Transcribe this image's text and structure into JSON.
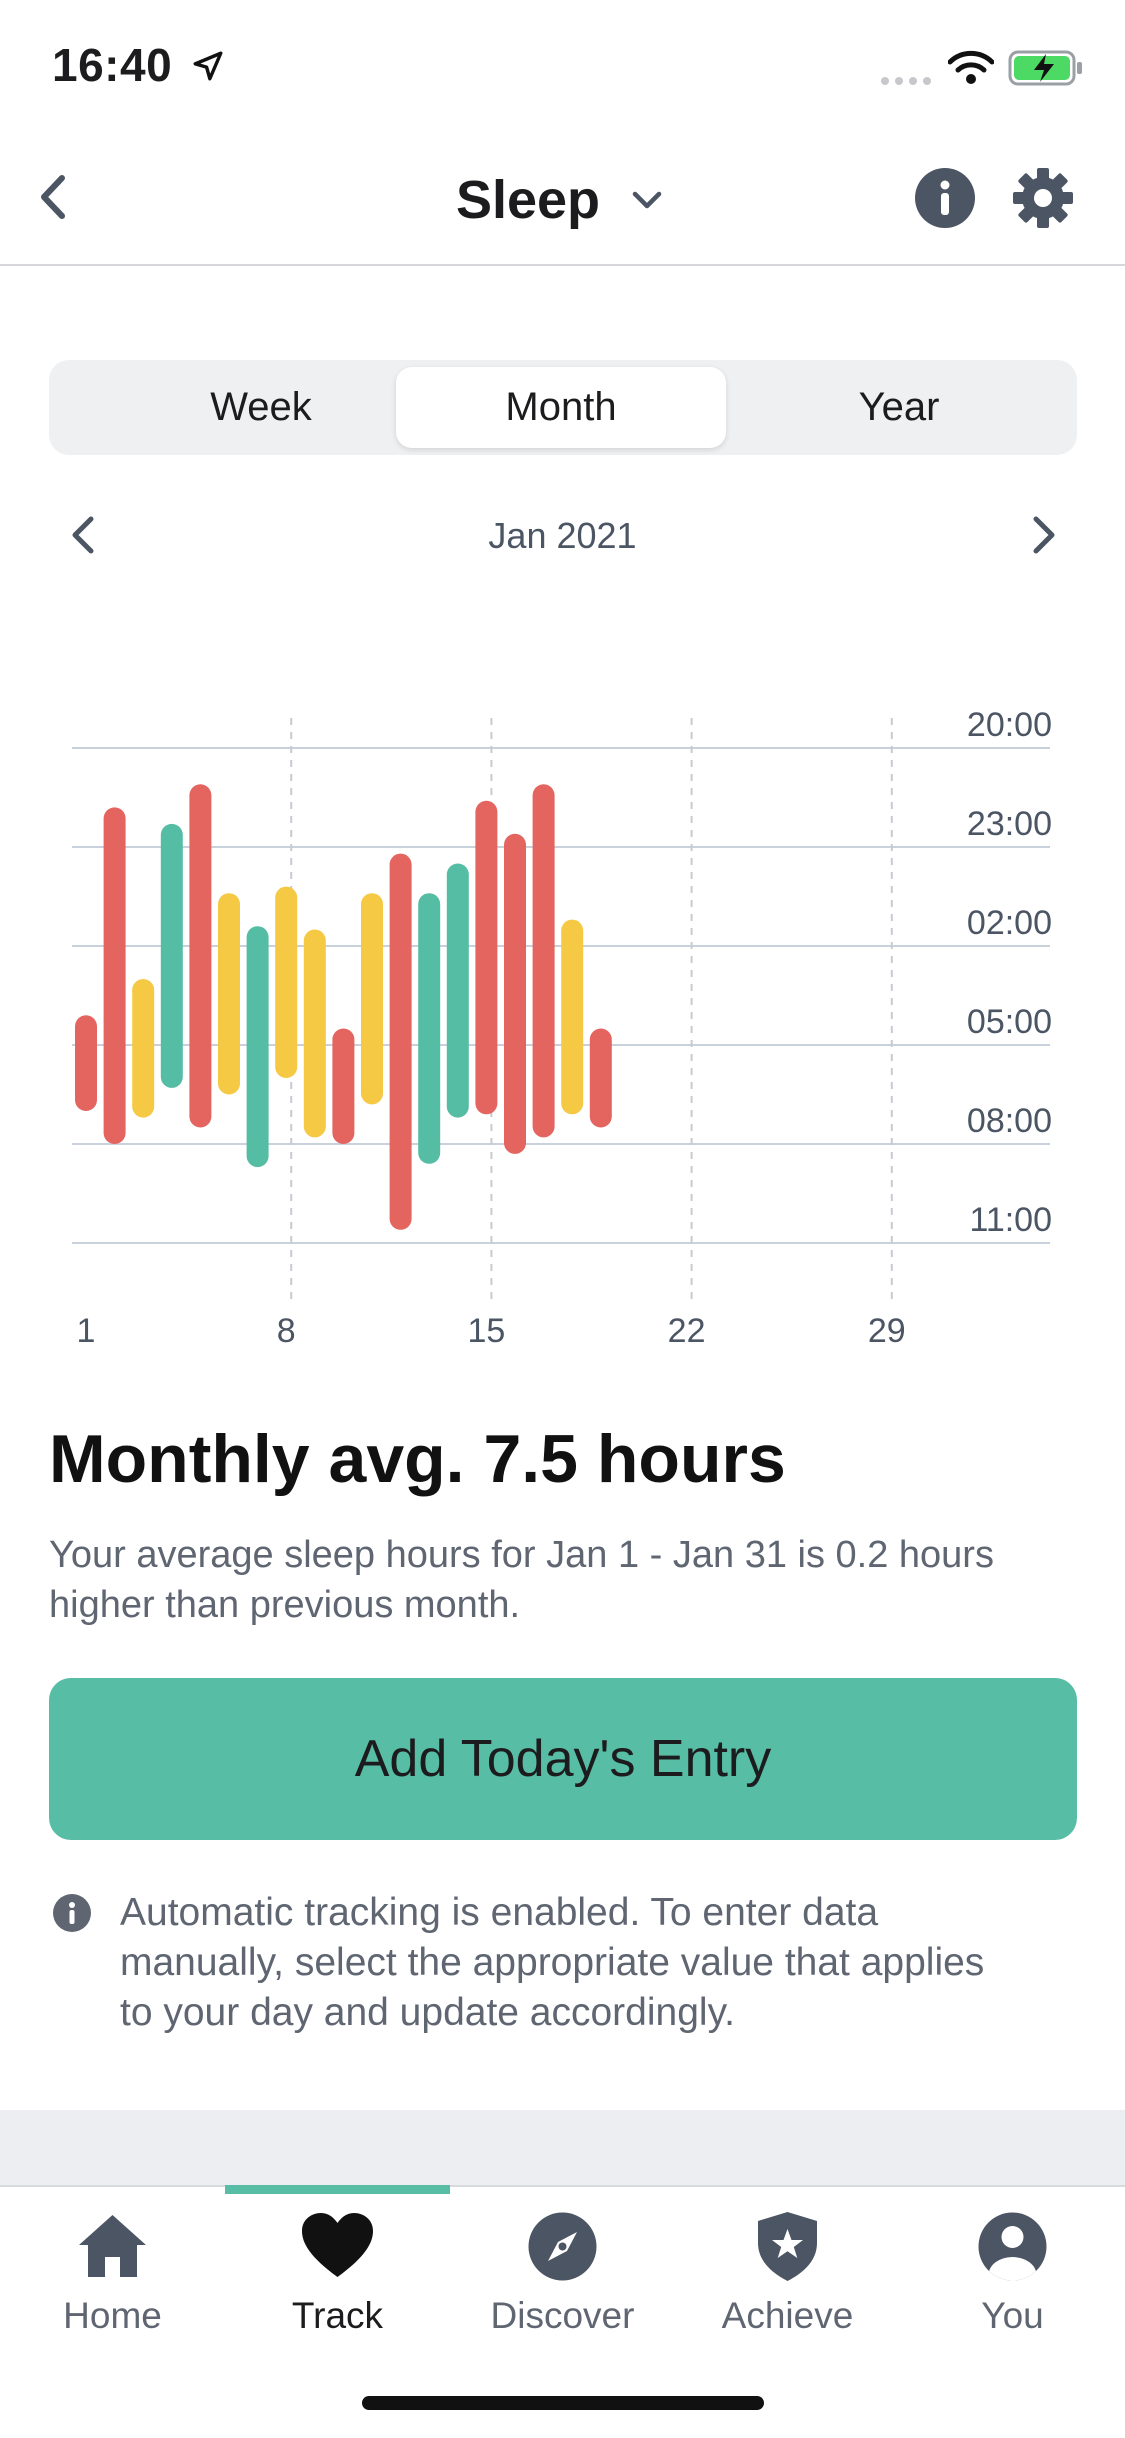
{
  "status_bar": {
    "time": "16:40"
  },
  "header": {
    "title": "Sleep"
  },
  "segments": [
    "Week",
    "Month",
    "Year"
  ],
  "segment_active": "Month",
  "period": {
    "label": "Jan 2021"
  },
  "chart_data": {
    "type": "bar",
    "description_units": "floating bars: start and end time of sleep, hours offset from 20:00",
    "y_tick_labels": [
      "20:00",
      "23:00",
      "02:00",
      "05:00",
      "08:00",
      "11:00"
    ],
    "y_range_hours_from_20": [
      0,
      15
    ],
    "x_tick_labels": [
      "1",
      "8",
      "15",
      "22",
      "29"
    ],
    "x_range_days": [
      1,
      31
    ],
    "bars": [
      {
        "day": 1,
        "start": 8.1,
        "end": 11.0,
        "color": "red"
      },
      {
        "day": 2,
        "start": 1.8,
        "end": 12.0,
        "color": "red"
      },
      {
        "day": 3,
        "start": 7.0,
        "end": 11.2,
        "color": "yellow"
      },
      {
        "day": 4,
        "start": 2.3,
        "end": 10.3,
        "color": "green"
      },
      {
        "day": 5,
        "start": 1.1,
        "end": 11.5,
        "color": "red"
      },
      {
        "day": 6,
        "start": 4.4,
        "end": 10.5,
        "color": "yellow"
      },
      {
        "day": 7,
        "start": 5.4,
        "end": 12.7,
        "color": "green"
      },
      {
        "day": 8,
        "start": 4.2,
        "end": 10.0,
        "color": "yellow"
      },
      {
        "day": 9,
        "start": 5.5,
        "end": 11.8,
        "color": "yellow"
      },
      {
        "day": 10,
        "start": 8.5,
        "end": 12.0,
        "color": "red"
      },
      {
        "day": 11,
        "start": 4.4,
        "end": 10.8,
        "color": "yellow"
      },
      {
        "day": 12,
        "start": 3.2,
        "end": 14.6,
        "color": "red"
      },
      {
        "day": 13,
        "start": 4.4,
        "end": 12.6,
        "color": "green"
      },
      {
        "day": 14,
        "start": 3.5,
        "end": 11.2,
        "color": "green"
      },
      {
        "day": 15,
        "start": 1.6,
        "end": 11.1,
        "color": "red"
      },
      {
        "day": 16,
        "start": 2.6,
        "end": 12.3,
        "color": "red"
      },
      {
        "day": 17,
        "start": 1.1,
        "end": 11.8,
        "color": "red"
      },
      {
        "day": 18,
        "start": 5.2,
        "end": 11.1,
        "color": "yellow"
      },
      {
        "day": 19,
        "start": 8.5,
        "end": 11.5,
        "color": "red"
      }
    ],
    "colors": {
      "red": "#e4655f",
      "yellow": "#f5c943",
      "green": "#55bda4"
    },
    "grid": true
  },
  "summary": {
    "title": "Monthly avg. 7.5 hours",
    "description": "Your average sleep hours for Jan 1 - Jan 31 is 0.2 hours higher than previous month."
  },
  "add_button": {
    "label": "Add Today's Entry"
  },
  "info_note": {
    "text": "Automatic tracking is enabled. To enter data manually, select the appropriate value that applies to your day and update accordingly."
  },
  "tabs": [
    {
      "label": "Home",
      "icon": "home-icon"
    },
    {
      "label": "Track",
      "icon": "heart-icon"
    },
    {
      "label": "Discover",
      "icon": "compass-icon"
    },
    {
      "label": "Achieve",
      "icon": "shield-star-icon"
    },
    {
      "label": "You",
      "icon": "person-icon"
    }
  ],
  "active_tab": "Track",
  "accent_color": "#57bda5"
}
